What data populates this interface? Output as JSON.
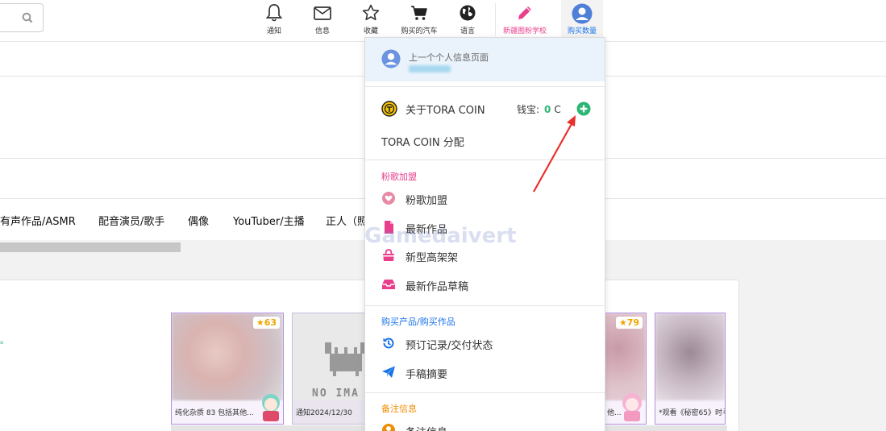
{
  "topnav": {
    "items": [
      {
        "label": "通知",
        "icon": "bell-icon"
      },
      {
        "label": "信息",
        "icon": "envelope-icon"
      },
      {
        "label": "收藏",
        "icon": "star-icon"
      },
      {
        "label": "购买的汽车",
        "icon": "cart-icon"
      },
      {
        "label": "语言",
        "icon": "globe-icon"
      },
      {
        "label": "新疆图粉学校",
        "icon": "pencil-icon"
      },
      {
        "label": "购买数量",
        "icon": "user-avatar-icon"
      }
    ]
  },
  "categories": [
    "有声作品/ASMR",
    "配音演员/歌手",
    "偶像",
    "YouTuber/主播",
    "正人（照"
  ],
  "dropdown": {
    "profile_label": "上一个个人信息页面",
    "coin_label": "关于TORA COIN",
    "wallet_label": "钱宝:",
    "wallet_value": "0",
    "wallet_unit": "C",
    "coin_distribution": "TORA COIN 分配",
    "section_fan": "粉歌加盟",
    "fan_items": [
      "粉歌加盟",
      "最新作品",
      "新型高架架",
      "最新作品草稿"
    ],
    "section_purchase": "购买产品/购买作品",
    "purchase_items": [
      "预订记录/交付状态",
      "手稿摘要"
    ],
    "section_notes": "备注信息",
    "notes_item": "备注信息"
  },
  "cards": [
    {
      "rating": "63",
      "caption": "纯化杂质 83 包括其他..."
    },
    {
      "rating": "",
      "caption": "通知2024/12/30",
      "noimage": "NO IMA"
    },
    {
      "rating": "79",
      "caption": "他..."
    },
    {
      "rating": "",
      "caption": "*观看《秘密65》时寻"
    }
  ],
  "left_text": "。",
  "watermark": "Gamedaivert",
  "colors": {
    "pink": "#e83e8c",
    "blue": "#1a73e8",
    "green": "#2bb673",
    "orange": "#f08c00"
  }
}
